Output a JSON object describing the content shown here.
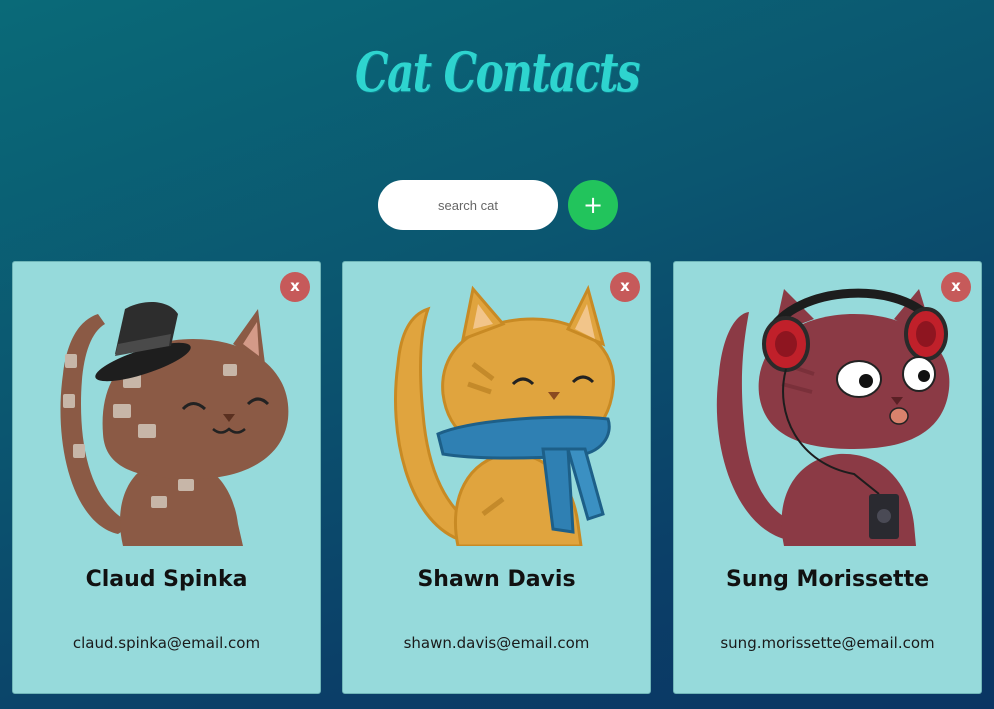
{
  "header": {
    "title": "Cat Contacts"
  },
  "search": {
    "placeholder": "search cat",
    "value": ""
  },
  "add_button": {
    "label": "+"
  },
  "cards": [
    {
      "name": "Claud Spinka",
      "email": "claud.spinka@email.com",
      "delete_label": "x",
      "avatar": "cat-brown-top-hat"
    },
    {
      "name": "Shawn Davis",
      "email": "shawn.davis@email.com",
      "delete_label": "x",
      "avatar": "cat-orange-blue-scarf"
    },
    {
      "name": "Sung Morissette",
      "email": "sung.morissette@email.com",
      "delete_label": "x",
      "avatar": "cat-maroon-headphones"
    }
  ],
  "colors": {
    "accent": "#2ed4cf",
    "card_bg": "#96dadb",
    "add": "#22c45c",
    "delete": "#c65a5a"
  }
}
